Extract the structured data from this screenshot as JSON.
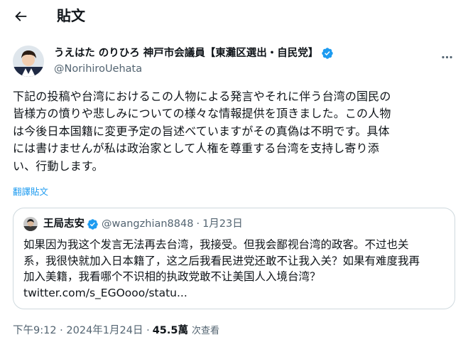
{
  "header": {
    "title": "貼文"
  },
  "author": {
    "name": "うえはた のりひろ 神戸市会議員【東灘区選出・自民党】",
    "handle": "@NorihiroUehata"
  },
  "tweet": {
    "lines": [
      "下記の投稿や台湾におけるこの人物による発言やそれに伴う台湾の国民の",
      "皆様方の憤りや悲しみについての様々な情報提供を頂きました。この人物",
      "は今後日本国籍に変更予定の旨述べていますがその真偽は不明です。具体",
      "には書けませんが私は政治家として人権を尊重する台湾を支持し寄り添",
      "い、行動します。"
    ],
    "translate_label": "翻譯貼文"
  },
  "quote": {
    "name": "王局志安",
    "handle": "@wangzhian8848",
    "date": "1月23日",
    "lines": [
      "如果因为我这个发言无法再去台湾，我接受。但我会鄙视台湾的政客。不过也关",
      "系，我很快就加入日本籍了，这之后我看民进党还敢不让我入关？如果有难度我再",
      "加入美籍，我看哪个不识相的执政党敢不让美国人入境台湾？",
      "twitter.com/s_EGOooo/statu..."
    ]
  },
  "meta": {
    "timestamp": "下午9:12 · 2024年1月24日 ·",
    "views_count": "45.5萬",
    "views_label": "次查看"
  },
  "colors": {
    "text": "#0f1419",
    "secondary": "#536471",
    "accent": "#1d9bf0",
    "border": "#cfd9de"
  },
  "icons": {
    "back": "arrow-left-icon",
    "verified": "verified-badge-icon",
    "more": "more-horizontal-icon"
  }
}
